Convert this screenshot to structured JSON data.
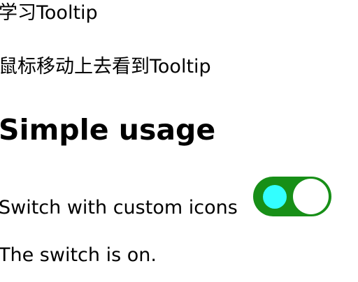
{
  "header": {
    "intro_text": "学习Tooltip",
    "hint_text": "鼠标移动上去看到Tooltip"
  },
  "section": {
    "title": "Simple usage"
  },
  "switch_control": {
    "label": "Switch with custom icons",
    "checked": true,
    "track_color": "#178f17",
    "icon_color": "#33ffff",
    "thumb_color": "#ffffff",
    "icon_name": "circle-dot-icon"
  },
  "status": {
    "text": "The switch is on."
  }
}
